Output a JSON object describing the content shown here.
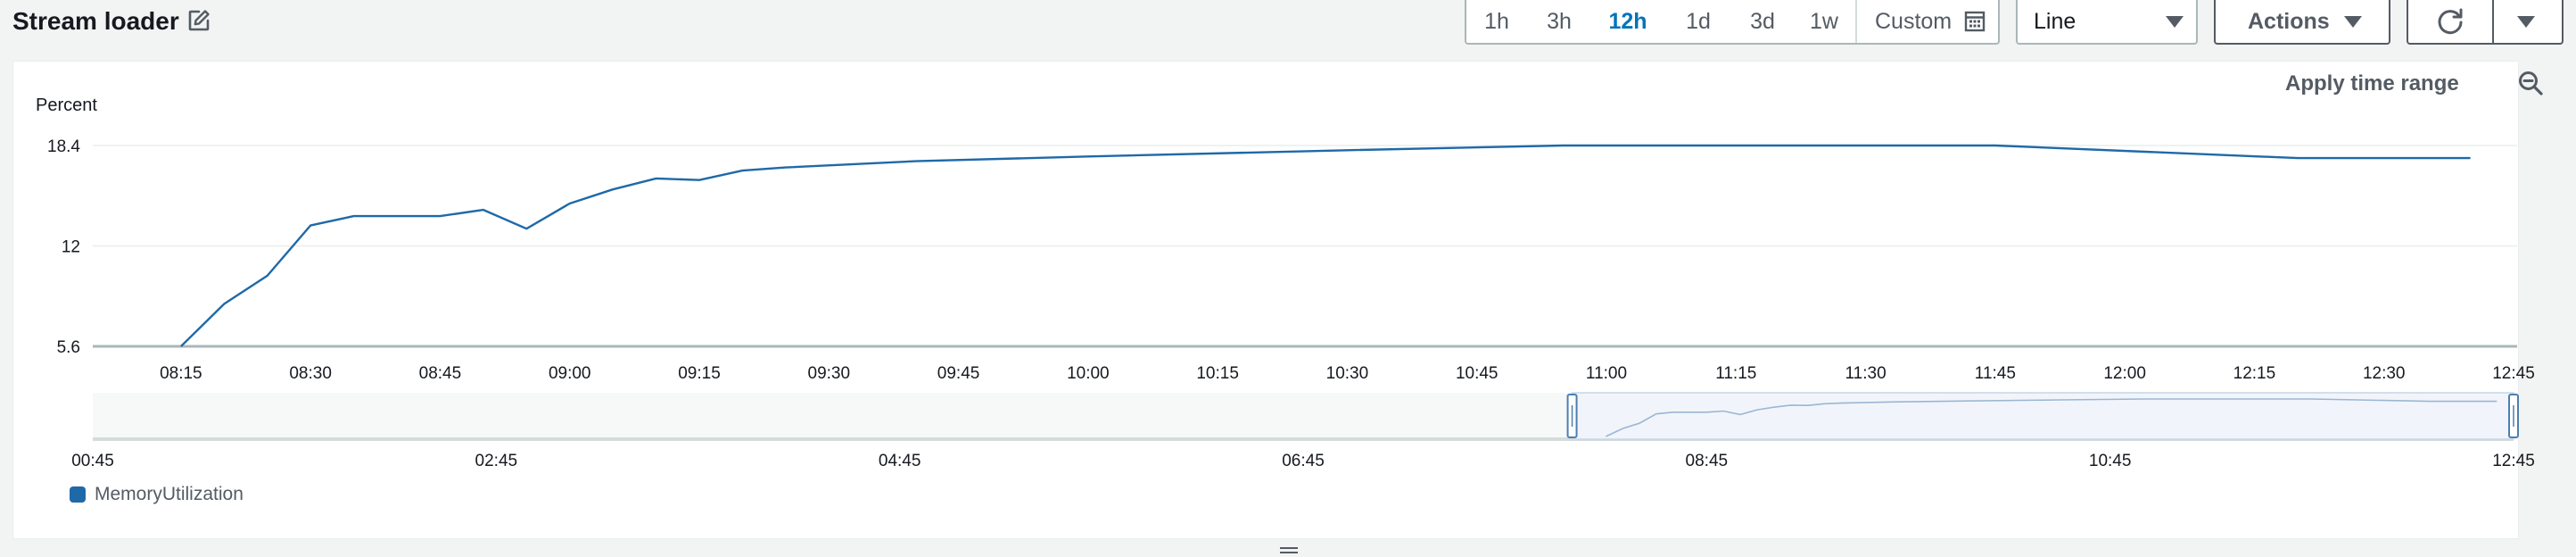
{
  "header": {
    "title": "Stream loader",
    "edit_icon": "edit-icon"
  },
  "time_range": {
    "options": [
      "1h",
      "3h",
      "12h",
      "1d",
      "3d",
      "1w"
    ],
    "selected": "12h",
    "custom_label": "Custom",
    "custom_icon": "calendar-icon"
  },
  "chart_type_select": {
    "value": "Line",
    "icon": "caret-down-icon"
  },
  "actions": {
    "label": "Actions",
    "icon": "caret-down-icon"
  },
  "refresh": {
    "icon": "refresh-icon",
    "menu_icon": "caret-down-icon"
  },
  "panel": {
    "apply_time_range": "Apply time range",
    "zoom_icon": "zoom-out-icon"
  },
  "colors": {
    "series": "#1f69a8",
    "accent": "#0073bb",
    "nav_fill": "#f1f5fb",
    "nav_handle": "#4c7fae"
  },
  "chart_data": {
    "type": "line",
    "ylabel": "Percent",
    "yticks": [
      "5.6",
      "12",
      "18.4"
    ],
    "ylim": [
      5.6,
      18.4
    ],
    "xticks": [
      "08:15",
      "08:30",
      "08:45",
      "09:00",
      "09:15",
      "09:30",
      "09:45",
      "10:00",
      "10:15",
      "10:30",
      "10:45",
      "11:00",
      "11:15",
      "11:30",
      "11:45",
      "12:00",
      "12:15",
      "12:30",
      "12:45"
    ],
    "x_range": [
      "08:05",
      "12:45"
    ],
    "grid": "horizontal",
    "legend_position": "bottom-left",
    "series": [
      {
        "name": "MemoryUtilization",
        "x": [
          "08:15",
          "08:20",
          "08:25",
          "08:30",
          "08:35",
          "08:40",
          "08:45",
          "08:50",
          "08:55",
          "09:00",
          "09:05",
          "09:10",
          "09:15",
          "09:20",
          "09:25",
          "09:40",
          "10:00",
          "10:30",
          "10:55",
          "11:45",
          "12:20",
          "12:40"
        ],
        "values": [
          5.6,
          8.3,
          10.1,
          13.3,
          13.9,
          13.9,
          13.9,
          14.3,
          13.1,
          14.7,
          15.6,
          16.3,
          16.2,
          16.8,
          17.0,
          17.4,
          17.7,
          18.1,
          18.4,
          18.4,
          17.6,
          17.6
        ]
      }
    ],
    "navigator": {
      "xticks": [
        "00:45",
        "02:45",
        "04:45",
        "06:45",
        "08:45",
        "10:45",
        "12:45"
      ],
      "x_range": [
        "00:45",
        "12:45"
      ],
      "selection": [
        "08:05",
        "12:45"
      ]
    }
  }
}
